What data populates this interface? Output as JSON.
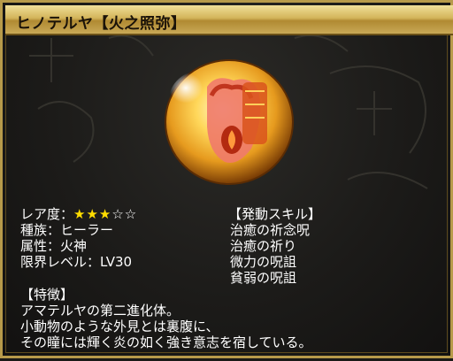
{
  "title": "ヒノテルヤ【火之照弥】",
  "colors": {
    "frame_gold": "#b79a4a",
    "star_filled": "#ffdd00",
    "text": "#ffffff"
  },
  "stats": {
    "rarity_label": "レア度：",
    "rarity_filled": "★★★",
    "rarity_empty": "☆☆",
    "rarity_value": 3,
    "rarity_max": 5,
    "race": "種族：ヒーラー",
    "attribute": "属性：火神",
    "level_limit": "限界レベル：LV30"
  },
  "skills": {
    "header": "【発動スキル】",
    "items": [
      "治癒の祈念呪",
      "治癒の祈り",
      "微力の呪詛",
      "貧弱の呪詛"
    ]
  },
  "feature": {
    "header": "【特徴】",
    "lines": [
      "アマテルヤの第二進化体。",
      "小動物のような外見とは裏腹に、",
      "その瞳には輝く炎の如く強き意志を宿している。"
    ]
  },
  "icons": {
    "portrait": "fire-spirit-orb-icon"
  }
}
